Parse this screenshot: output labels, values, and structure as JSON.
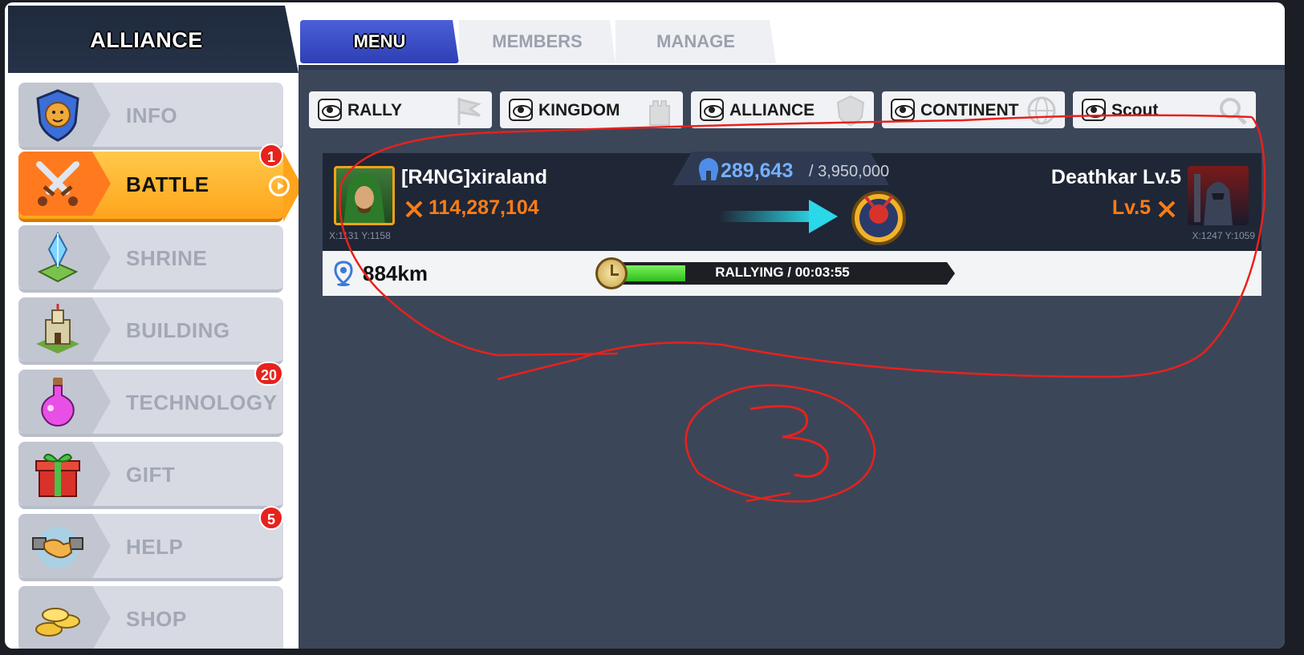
{
  "header": {
    "title": "ALLIANCE"
  },
  "tabs": [
    {
      "label": "MENU",
      "active": true
    },
    {
      "label": "MEMBERS",
      "active": false
    },
    {
      "label": "MANAGE",
      "active": false
    }
  ],
  "sidebar": {
    "items": [
      {
        "label": "INFO",
        "icon": "lion-shield-icon",
        "badge": ""
      },
      {
        "label": "BATTLE",
        "icon": "crossed-swords-icon",
        "badge": "1",
        "active": true
      },
      {
        "label": "SHRINE",
        "icon": "crystal-shrine-icon",
        "badge": ""
      },
      {
        "label": "BUILDING",
        "icon": "castle-icon",
        "badge": ""
      },
      {
        "label": "TECHNOLOGY",
        "icon": "potion-flask-icon",
        "badge": "20"
      },
      {
        "label": "GIFT",
        "icon": "gift-box-icon",
        "badge": ""
      },
      {
        "label": "HELP",
        "icon": "handshake-icon",
        "badge": "5"
      },
      {
        "label": "SHOP",
        "icon": "gold-coins-icon",
        "badge": ""
      }
    ]
  },
  "filters": [
    {
      "label": "RALLY",
      "icon": "flag-icon"
    },
    {
      "label": "KINGDOM",
      "icon": "castle-tower-icon"
    },
    {
      "label": "ALLIANCE",
      "icon": "alliance-crest-icon"
    },
    {
      "label": "CONTINENT",
      "icon": "globe-icon"
    },
    {
      "label": "Scout",
      "icon": "magnifier-icon"
    }
  ],
  "battle": {
    "attacker": {
      "name": "[R4NG]xiraland",
      "power": "114,287,104",
      "coords": "X:1131 Y:1158"
    },
    "target": {
      "name": "Deathkar Lv.5",
      "level": "Lv.5",
      "coords": "X:1247 Y:1059"
    },
    "troops_current": "289,643",
    "troops_max": "/ 3,950,000",
    "distance": "884km",
    "status": "RALLYING / 00:03:55",
    "progress": 0.2
  },
  "annotation": {
    "number": "3",
    "color": "#e8211c"
  },
  "colors": {
    "accent_orange": "#ffa41b",
    "power_orange": "#ff7c16",
    "troops_blue": "#74b0ff",
    "menu_blue": "#3e50c9"
  }
}
